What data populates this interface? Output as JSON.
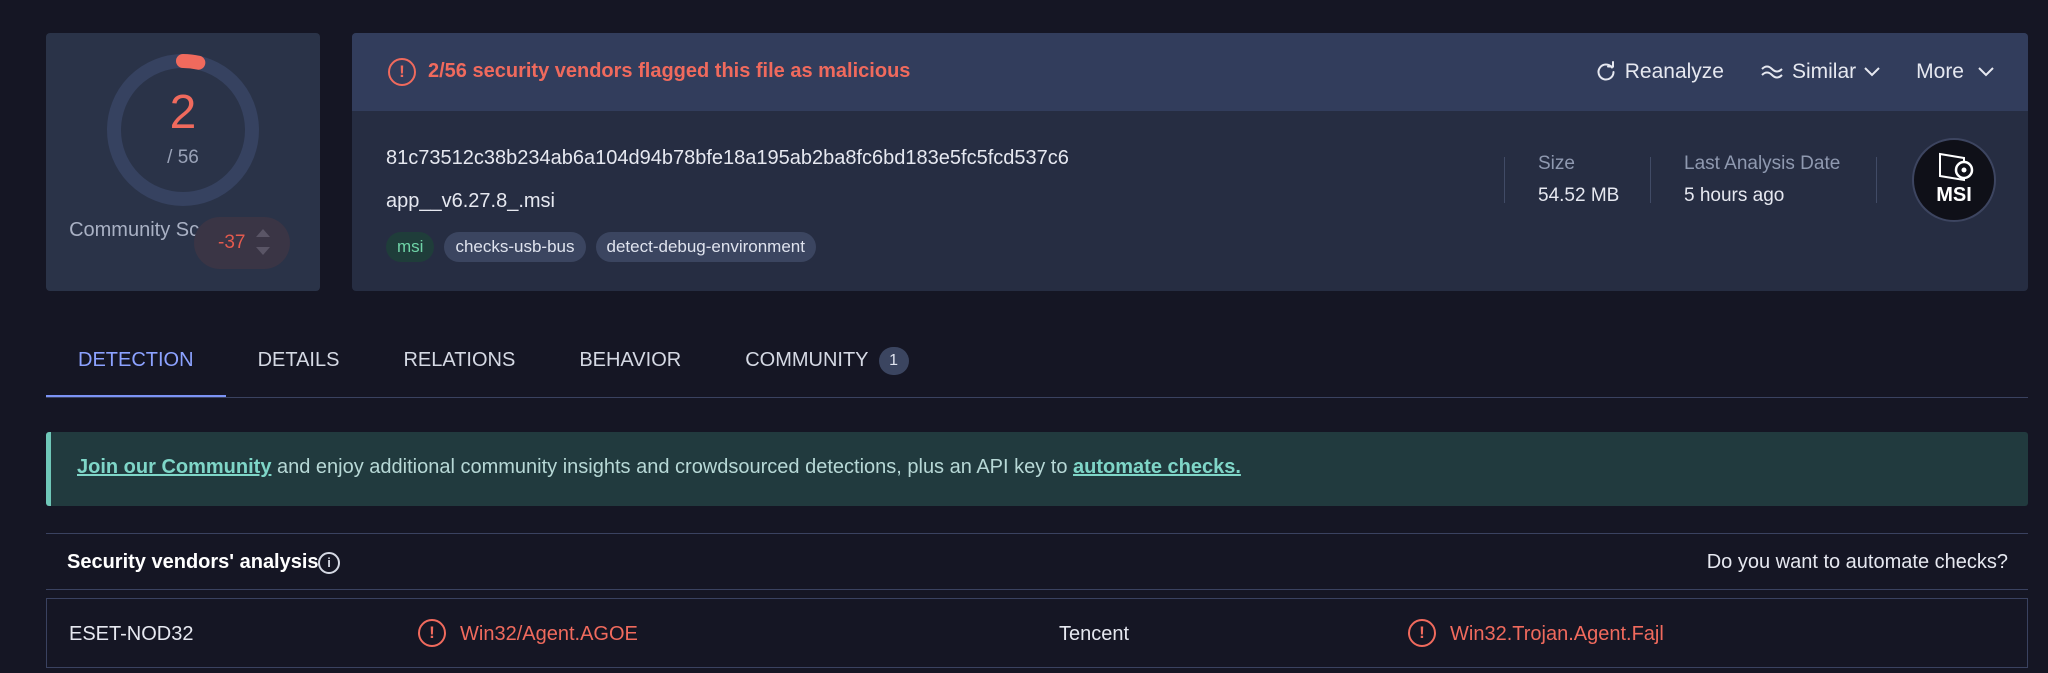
{
  "score": {
    "detections": "2",
    "total": "/ 56",
    "detection_ratio": 0.0357,
    "community_label": "Community Score",
    "community_value": "-37",
    "accent_color": "#f06a5d"
  },
  "alert": {
    "icon": "alert-circle-icon",
    "text": "2/56 security vendors flagged this file as malicious"
  },
  "actions": {
    "reanalyze": "Reanalyze",
    "similar": "Similar",
    "more": "More"
  },
  "file": {
    "hash": "81c73512c38b234ab6a104d94b78bfe18a195ab2ba8fc6bd183e5fc5fcd537c6",
    "name": "app__v6.27.8_.msi",
    "tags": [
      "msi",
      "checks-usb-bus",
      "detect-debug-environment"
    ],
    "size_label": "Size",
    "size_value": "54.52 MB",
    "date_label": "Last Analysis Date",
    "date_value": "5 hours ago",
    "type_badge": "MSI"
  },
  "tabs": [
    {
      "label": "DETECTION",
      "active": true
    },
    {
      "label": "DETAILS"
    },
    {
      "label": "RELATIONS"
    },
    {
      "label": "BEHAVIOR"
    },
    {
      "label": "COMMUNITY",
      "count": "1"
    }
  ],
  "banner": {
    "link1": "Join our Community",
    "middle": " and enjoy additional community insights and crowdsourced detections, plus an API key to ",
    "link2": "automate checks."
  },
  "analysis": {
    "title": "Security vendors' analysis",
    "automate": "Do you want to automate checks?",
    "rows": [
      {
        "vendor1": "ESET-NOD32",
        "result1": "Win32/Agent.AGOE",
        "vendor2": "Tencent",
        "result2": "Win32.Trojan.Agent.Fajl"
      }
    ]
  }
}
